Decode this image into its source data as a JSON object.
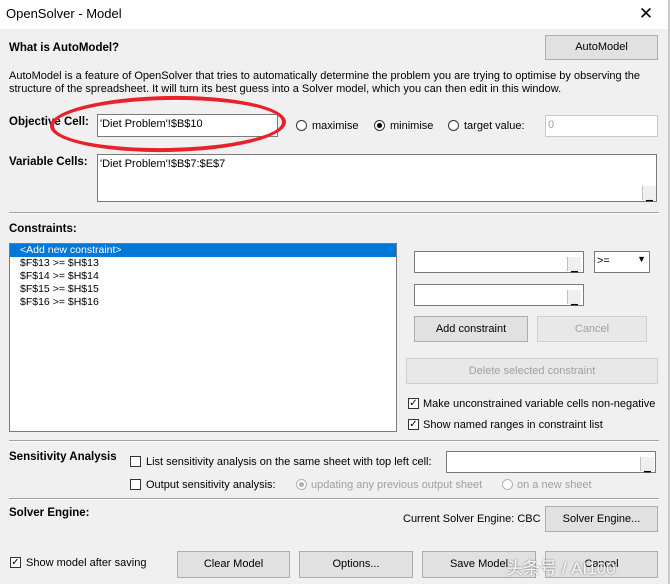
{
  "window": {
    "title": "OpenSolver - Model",
    "close_glyph": "✕"
  },
  "automodel": {
    "heading": "What is AutoModel?",
    "button": "AutoModel",
    "description": "AutoModel is a feature of OpenSolver that tries to automatically determine the problem you are trying to optimise by observing the structure of the spreadsheet. It will turn its best guess into a Solver model, which you can then edit in this window."
  },
  "objective": {
    "label": "Objective Cell:",
    "value": "'Diet Problem'!$B$10",
    "options": {
      "maximise": "maximise",
      "minimise": "minimise",
      "target": "target value:"
    },
    "selected": "minimise",
    "target_value": "0"
  },
  "variables": {
    "label": "Variable Cells:",
    "value": "'Diet Problem'!$B$7:$E$7"
  },
  "constraints": {
    "label": "Constraints:",
    "items": [
      "<Add new constraint>",
      "$F$13 >= $H$13",
      "$F$14 >= $H$14",
      "$F$15 >= $H$15",
      "$F$16 >= $H$16"
    ],
    "relation": ">=",
    "add_button": "Add constraint",
    "cancel_button": "Cancel",
    "delete_button": "Delete selected constraint",
    "nonneg_label": "Make unconstrained variable cells non-negative",
    "nonneg_checked": true,
    "named_ranges_label": "Show named ranges in constraint list",
    "named_ranges_checked": true
  },
  "sensitivity": {
    "label": "Sensitivity Analysis",
    "same_sheet_label": "List sensitivity analysis on the same sheet with top left cell:",
    "output_label": "Output sensitivity analysis:",
    "updating_label": "updating any previous output sheet",
    "new_sheet_label": "on a new sheet"
  },
  "engine": {
    "label": "Solver Engine:",
    "current": "Current Solver Engine: CBC",
    "button": "Solver Engine..."
  },
  "footer": {
    "show_model_label": "Show model after saving",
    "show_model_checked": true,
    "clear": "Clear Model",
    "options": "Options...",
    "save": "Save Model",
    "cancel": "Cancel"
  },
  "watermark": "头条号 / AI100",
  "accent_color": "#0078d7",
  "annotation_color": "#e8212a"
}
